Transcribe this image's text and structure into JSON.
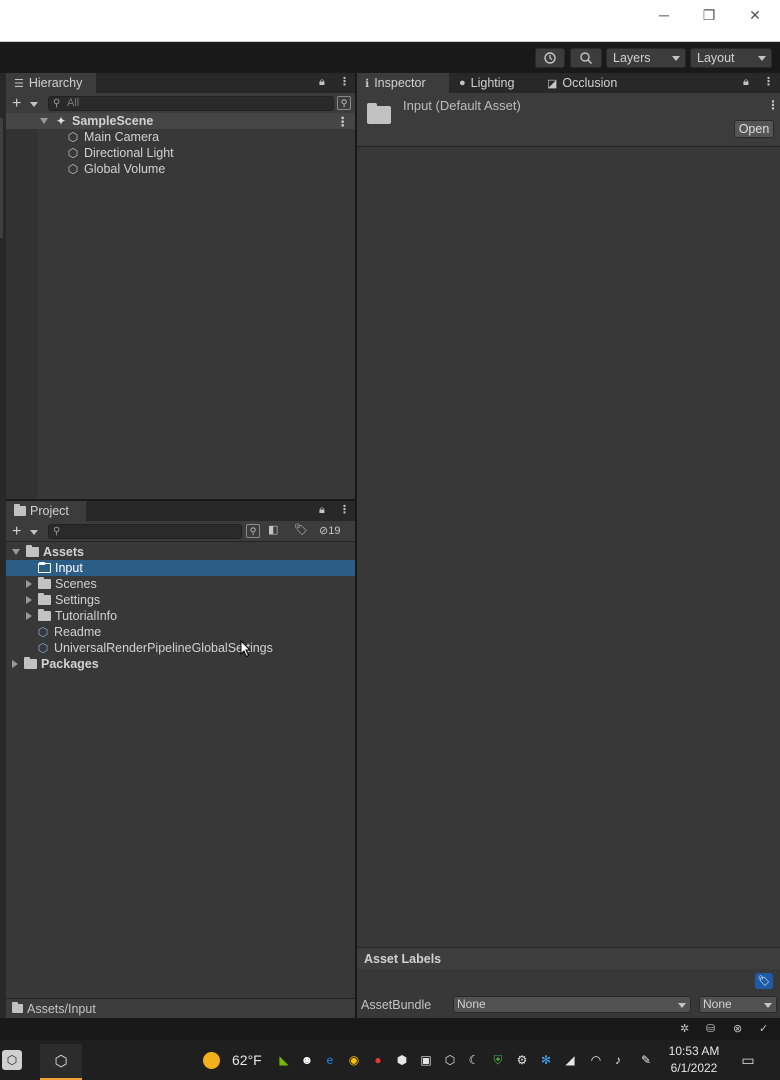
{
  "window": {
    "minimize": "─",
    "restore": "❐",
    "close": "✕"
  },
  "toolbar": {
    "history_icon": "history-icon",
    "search_icon": "search-icon",
    "layers_label": "Layers",
    "layout_label": "Layout"
  },
  "hierarchy": {
    "tab_label": "Hierarchy",
    "search_placeholder": "All",
    "scene_name": "SampleScene",
    "items": [
      {
        "label": "Main Camera"
      },
      {
        "label": "Directional Light"
      },
      {
        "label": "Global Volume"
      }
    ]
  },
  "inspector": {
    "tabs": [
      {
        "label": "Inspector"
      },
      {
        "label": "Lighting"
      },
      {
        "label": "Occlusion"
      }
    ],
    "asset_title": "Input (Default Asset)",
    "open_button": "Open",
    "asset_labels_title": "Asset Labels",
    "assetbundle_label": "AssetBundle",
    "assetbundle_value": "None",
    "variant_value": "None"
  },
  "project": {
    "tab_label": "Project",
    "hidden_count": "19",
    "tree": [
      {
        "label": "Assets",
        "bold": true
      },
      {
        "label": "Input",
        "selected": true
      },
      {
        "label": "Scenes"
      },
      {
        "label": "Settings"
      },
      {
        "label": "TutorialInfo"
      },
      {
        "label": "Readme"
      },
      {
        "label": "UniversalRenderPipelineGlobalSettings"
      },
      {
        "label": "Packages",
        "bold": true
      }
    ],
    "footer_path": "Assets/Input"
  },
  "taskbar": {
    "weather_temp": "62°F",
    "time": "10:53 AM",
    "date": "6/1/2022"
  },
  "colors": {
    "selection": "#2c5d87",
    "panel_bg": "#383838",
    "window_bg": "#191919"
  }
}
